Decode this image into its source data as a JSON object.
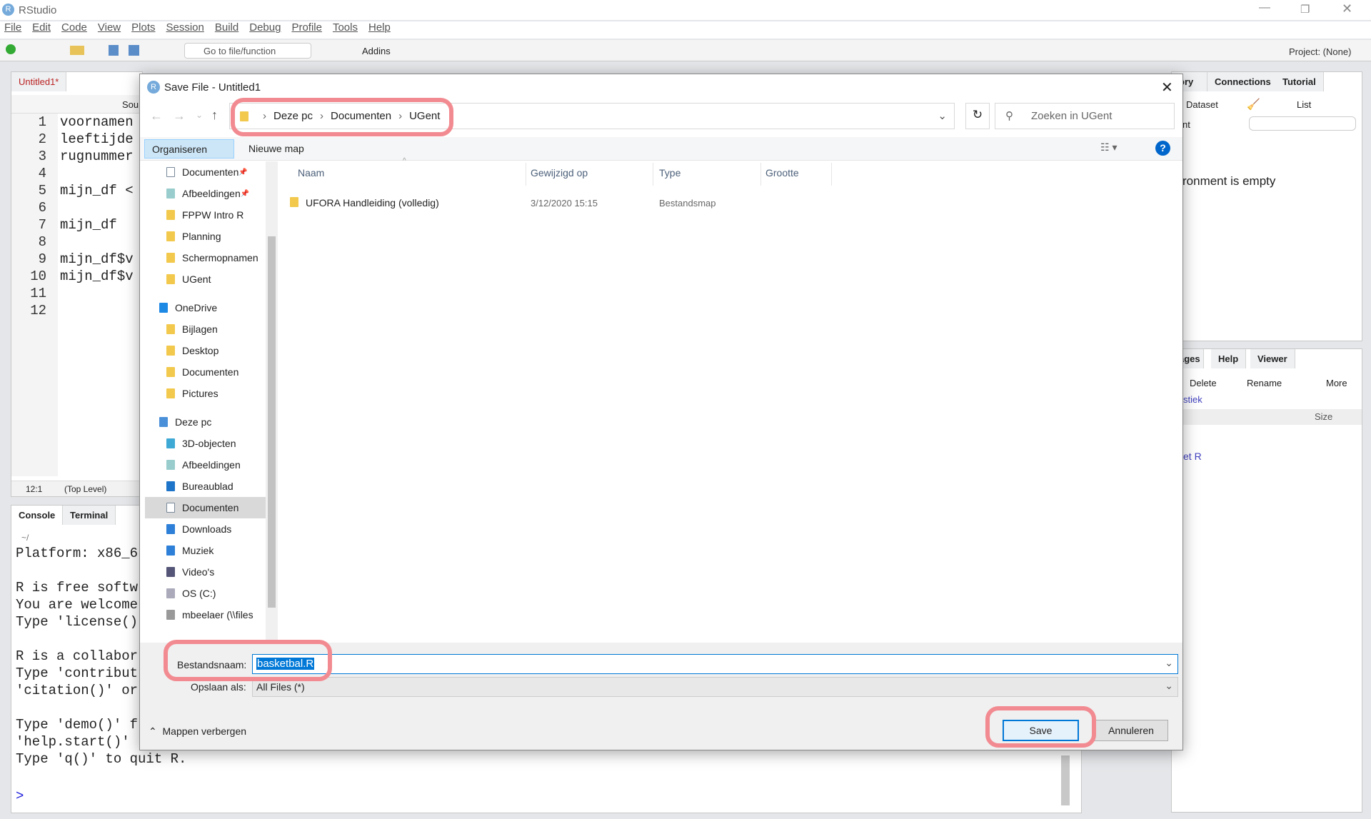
{
  "app": {
    "title": "RStudio",
    "menu": [
      "File",
      "Edit",
      "Code",
      "View",
      "Plots",
      "Session",
      "Build",
      "Debug",
      "Profile",
      "Tools",
      "Help"
    ],
    "toolbar": {
      "goto_placeholder": "Go to file/function",
      "addins": "Addins",
      "project": "Project: (None)"
    }
  },
  "editor": {
    "tab": "Untitled1*",
    "source_label": "Sou",
    "lines": [
      "voornamen",
      "leeftijde",
      "rugnummer",
      "",
      "mijn_df <",
      "",
      "mijn_df",
      "",
      "mijn_df$v",
      "mijn_df$v",
      "",
      ""
    ],
    "status_pos": "12:1",
    "status_scope": "(Top Level)"
  },
  "console": {
    "tabs": [
      "Console",
      "Terminal"
    ],
    "path": "~/",
    "lines": [
      "Platform: x86_6",
      "",
      "R is free softw",
      "You are welcome",
      "Type 'license()",
      "",
      "R is a collabor",
      "Type 'contribut",
      "'citation()' or",
      "",
      "Type 'demo()' f",
      "'help.start()'",
      "Type 'q()' to quit R."
    ],
    "prompt": ">"
  },
  "env_pane": {
    "tabs": [
      "ory",
      "Connections",
      "Tutorial"
    ],
    "dataset": "Dataset",
    "list": "List",
    "env_label": "nt",
    "empty_msg": "ronment is empty"
  },
  "files_pane": {
    "tabs": [
      "ages",
      "Help",
      "Viewer"
    ],
    "delete": "Delete",
    "rename": "Rename",
    "more": "More",
    "path": "stiek",
    "size_header": "Size",
    "item": "et R"
  },
  "dialog": {
    "title": "Save File - Untitled1",
    "breadcrumb": [
      "Deze pc",
      "Documenten",
      "UGent"
    ],
    "search_placeholder": "Zoeken in UGent",
    "organize": "Organiseren",
    "new_folder": "Nieuwe map",
    "nav": [
      {
        "label": "Documenten",
        "icon": "doc",
        "pinned": true
      },
      {
        "label": "Afbeeldingen",
        "icon": "pictures",
        "pinned": true
      },
      {
        "label": "FPPW Intro R",
        "icon": "folder"
      },
      {
        "label": "Planning",
        "icon": "folder"
      },
      {
        "label": "Schermopnamen",
        "icon": "folder"
      },
      {
        "label": "UGent",
        "icon": "folder"
      },
      {
        "label": "OneDrive",
        "icon": "cloud",
        "top": true
      },
      {
        "label": "Bijlagen",
        "icon": "folder"
      },
      {
        "label": "Desktop",
        "icon": "folder"
      },
      {
        "label": "Documenten",
        "icon": "folder"
      },
      {
        "label": "Pictures",
        "icon": "folder"
      },
      {
        "label": "Deze pc",
        "icon": "pc",
        "top": true
      },
      {
        "label": "3D-objecten",
        "icon": "3d"
      },
      {
        "label": "Afbeeldingen",
        "icon": "pictures"
      },
      {
        "label": "Bureaublad",
        "icon": "desktop"
      },
      {
        "label": "Documenten",
        "icon": "doc",
        "selected": true
      },
      {
        "label": "Downloads",
        "icon": "download"
      },
      {
        "label": "Muziek",
        "icon": "music"
      },
      {
        "label": "Video's",
        "icon": "video"
      },
      {
        "label": "OS (C:)",
        "icon": "drive"
      },
      {
        "label": "mbeelaer (\\\\files",
        "icon": "netdrive"
      }
    ],
    "columns": [
      "Naam",
      "Gewijzigd op",
      "Type",
      "Grootte"
    ],
    "files": [
      {
        "name": "UFORA Handleiding (volledig)",
        "modified": "3/12/2020 15:15",
        "type": "Bestandsmap",
        "size": ""
      }
    ],
    "filename_label": "Bestandsnaam:",
    "filename": "basketbal.R",
    "savetype_label": "Opslaan als:",
    "savetype": "All Files  (*)",
    "hide_folders": "Mappen verbergen",
    "save": "Save",
    "cancel": "Annuleren"
  },
  "colors": {
    "highlight": "#f28b91",
    "selection": "#0078d7",
    "accent": "#0066cc"
  }
}
